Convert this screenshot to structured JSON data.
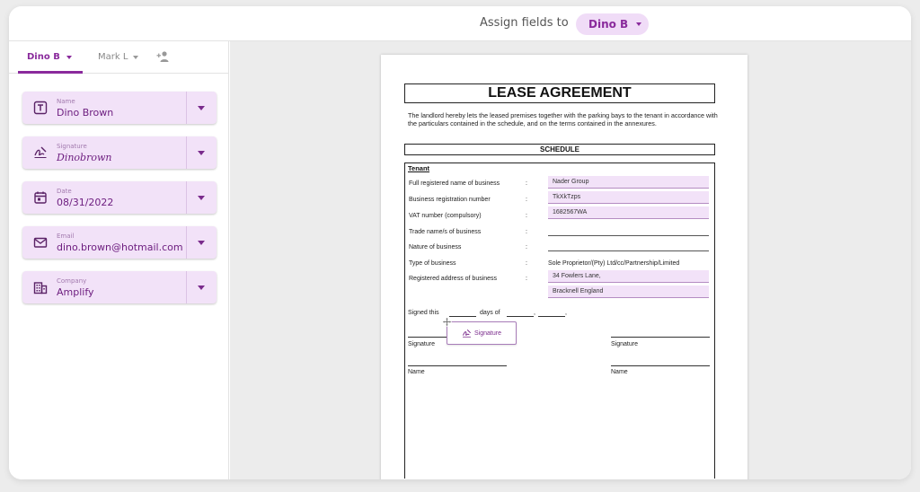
{
  "header": {
    "assign_label": "Assign fields to",
    "assignee": "Dino B",
    "caret_icon": "caret-down-icon"
  },
  "colors": {
    "accent": "#8a2a9c",
    "field_bg": "#f2e2f8",
    "pill_bg": "#f0dcf7",
    "canvas_bg": "#ececec"
  },
  "sidebar": {
    "tabs": [
      {
        "label": "Dino B",
        "active": true
      },
      {
        "label": "Mark L",
        "active": false
      }
    ],
    "add_user_icon": "add-user-icon",
    "fields": [
      {
        "label": "Name",
        "value": "Dino Brown",
        "icon": "text-field-icon"
      },
      {
        "label": "Signature",
        "value": "Dinobrown",
        "icon": "signature-icon"
      },
      {
        "label": "Date",
        "value": "08/31/2022",
        "icon": "calendar-icon"
      },
      {
        "label": "Email",
        "value": "dino.brown@hotmail.com",
        "icon": "envelope-icon"
      },
      {
        "label": "Company",
        "value": "Amplify",
        "icon": "building-icon"
      }
    ]
  },
  "document": {
    "title": "LEASE AGREEMENT",
    "intro": "The landlord hereby lets the leased premises together with the parking bays to the tenant in accordance with the particulars contained in the schedule, and on the terms contained in the annexures.",
    "schedule_heading": "SCHEDULE",
    "tenant_heading": "Tenant",
    "rows": [
      {
        "label": "Full registered name of business",
        "value": "Nader Group",
        "filled": true
      },
      {
        "label": "Business registration number",
        "value": "TkXkTzps",
        "filled": true
      },
      {
        "label": "VAT number (compulsory)",
        "value": "1682567WA",
        "filled": true
      },
      {
        "label": "Trade name/s of business",
        "value": "",
        "filled": false
      },
      {
        "label": "Nature of business",
        "value": "",
        "filled": false
      },
      {
        "label": "Type of business",
        "value": "Sole Proprietor/(Pty) Ltd/cc/Partnership/Limited",
        "filled": false
      },
      {
        "label": "Registered address of business",
        "value": "34 Fowlers Lane,",
        "filled": true
      }
    ],
    "address_line2": "Bracknell England",
    "colon": ":",
    "signed_this": "Signed this",
    "days_of": "days of",
    "comma": ",",
    "period": ",",
    "signature_label_left": "Signature",
    "signature_label_right": "Signature",
    "name_label_left": "Name",
    "name_label_right": "Name",
    "signature_field_label": "Signature"
  }
}
